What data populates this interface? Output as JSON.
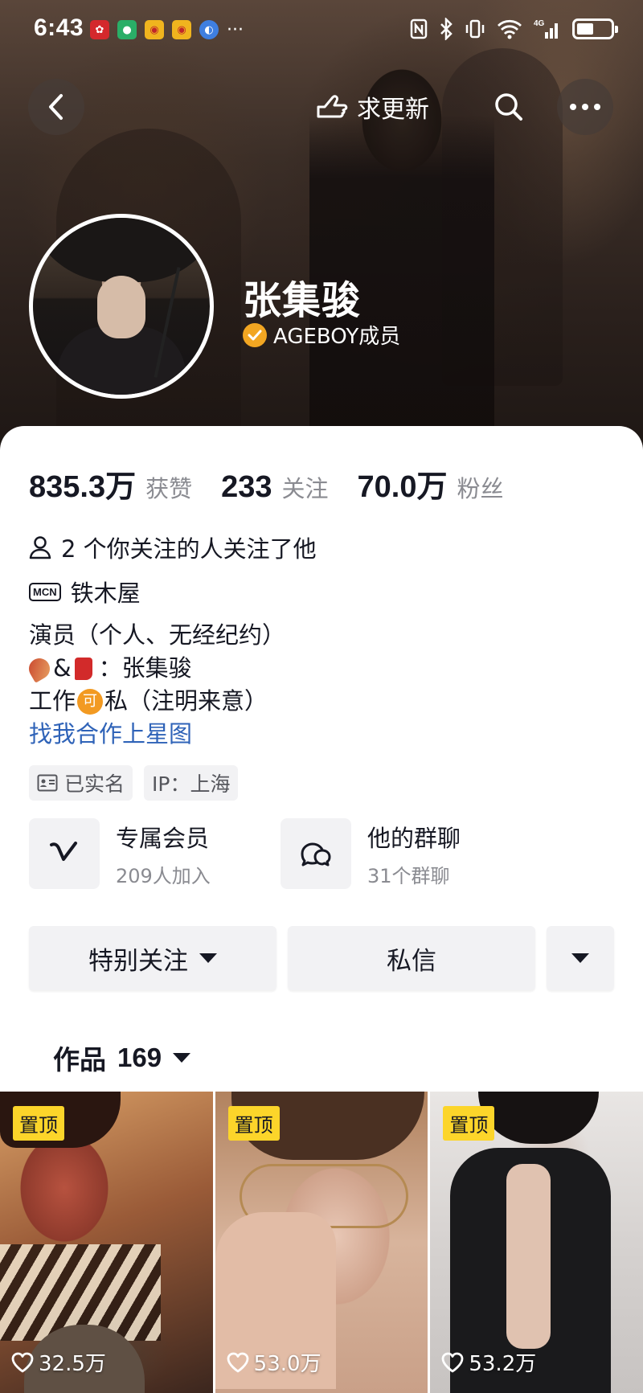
{
  "status_bar": {
    "time": "6:43",
    "notification_icons": [
      "huawei-icon",
      "wechat-icon",
      "weibo-icon",
      "weibo-icon",
      "browser-icon"
    ],
    "more": "···",
    "network": "4G"
  },
  "nav": {
    "update_label": "求更新"
  },
  "profile": {
    "name": "张集骏",
    "verified_label": "AGEBOY成员",
    "verified_color": "#f2a622"
  },
  "stats": [
    {
      "value": "835.3万",
      "label": "获赞"
    },
    {
      "value": "233",
      "label": "关注"
    },
    {
      "value": "70.0万",
      "label": "粉丝"
    }
  ],
  "mutual_follow": "2 个你关注的人关注了他",
  "mcn": {
    "icon_text": "MCN",
    "name": "铁木屋"
  },
  "bio": {
    "line1": "演员（个人、无经纪约）",
    "line2_amp": "&",
    "line2_text": "：张集骏",
    "line3_prefix": "工作",
    "line3_badge": "可",
    "line3_suffix": "私（注明来意）",
    "link": "找我合作上星图",
    "link_color": "#2f63b8"
  },
  "tags": [
    {
      "icon": "id-card-icon",
      "label": "已实名"
    },
    {
      "label": "IP：上海"
    }
  ],
  "features": {
    "member": {
      "title": "专属会员",
      "sub": "209人加入"
    },
    "group": {
      "title": "他的群聊",
      "sub": "31个群聊"
    }
  },
  "actions": {
    "follow": "特别关注",
    "message": "私信"
  },
  "works": {
    "label": "作品",
    "count": "169"
  },
  "grid": [
    {
      "pin": "置顶",
      "likes": "32.5万"
    },
    {
      "pin": "置顶",
      "likes": "53.0万"
    },
    {
      "pin": "置顶",
      "likes": "53.2万"
    }
  ]
}
